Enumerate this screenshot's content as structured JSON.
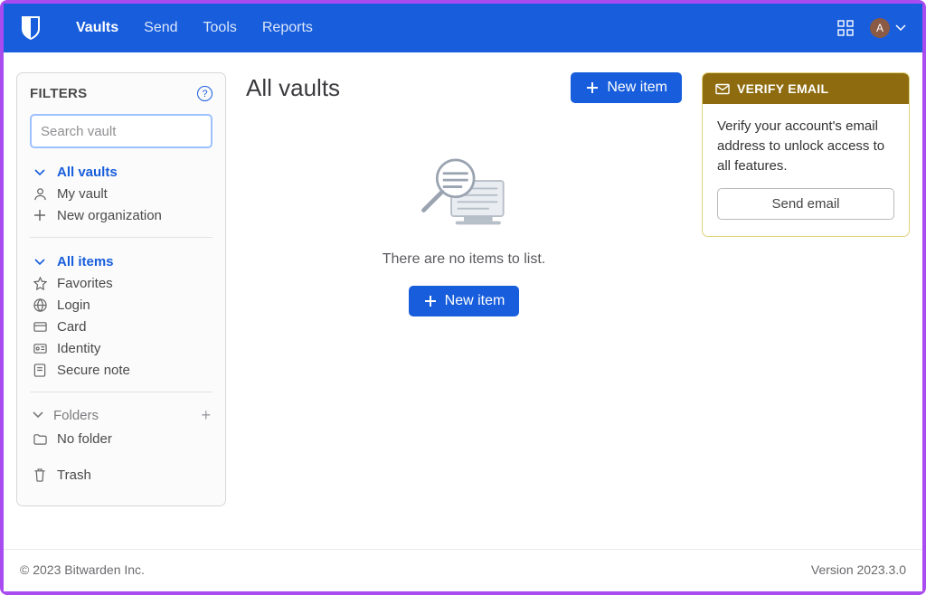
{
  "nav": {
    "items": [
      "Vaults",
      "Send",
      "Tools",
      "Reports"
    ],
    "active_index": 0
  },
  "account": {
    "initial": "A"
  },
  "sidebar": {
    "filters_label": "FILTERS",
    "search_placeholder": "Search vault",
    "vaults": {
      "all": "All vaults",
      "my": "My vault",
      "new_org": "New organization"
    },
    "items": {
      "all": "All items",
      "favorites": "Favorites",
      "login": "Login",
      "card": "Card",
      "identity": "Identity",
      "note": "Secure note"
    },
    "folders_label": "Folders",
    "no_folder": "No folder",
    "trash": "Trash"
  },
  "main": {
    "title": "All vaults",
    "new_item_label": "New item",
    "empty_text": "There are no items to list."
  },
  "verify": {
    "heading": "VERIFY EMAIL",
    "body": "Verify your account's email address to unlock access to all features.",
    "button": "Send email"
  },
  "footer": {
    "copyright": "© 2023 Bitwarden Inc.",
    "version": "Version 2023.3.0"
  }
}
